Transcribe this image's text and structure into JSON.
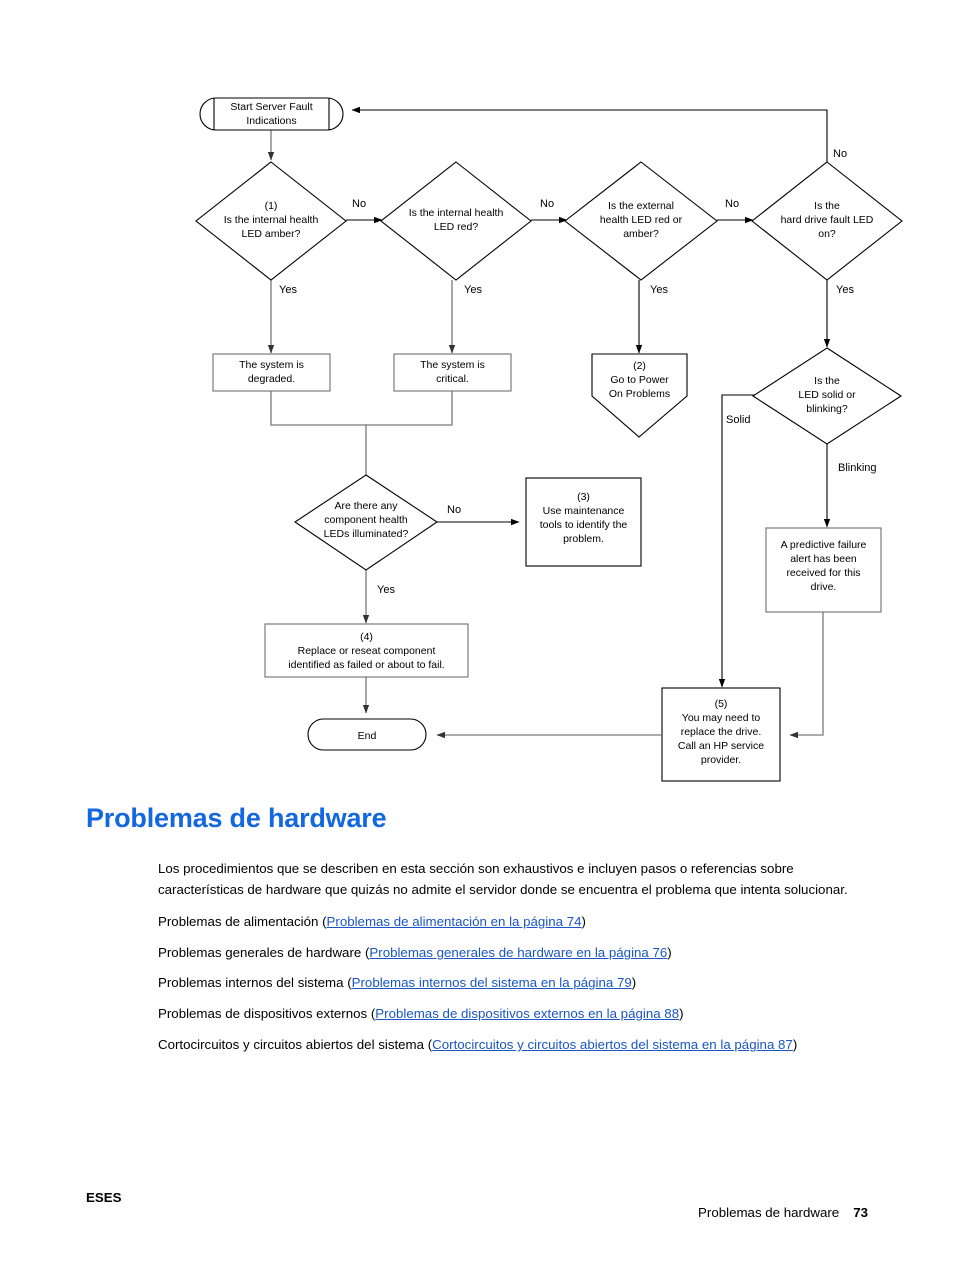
{
  "document": {
    "page_title": "Problemas de hardware",
    "heading_color": "#1367e0",
    "link_color": "#1a56c4"
  },
  "flowchart": {
    "title": "Server Fault Indications flowchart",
    "nodes": {
      "start": {
        "line1": "Start Server Fault",
        "line2": "Indications"
      },
      "q_internal_amber": {
        "line1": "(1)",
        "line2": "Is the internal health",
        "line3": "LED amber?"
      },
      "q_internal_red": {
        "line1": "Is the internal health",
        "line2": "LED red?"
      },
      "q_external": {
        "line1": "Is the external",
        "line2": "health LED red or",
        "line3": "amber?"
      },
      "q_hdd_fault": {
        "line1": "Is the",
        "line2": "hard drive fault LED",
        "line3": "on?"
      },
      "box_degraded": {
        "line1": "The system is",
        "line2": "degraded."
      },
      "box_critical": {
        "line1": "The system is",
        "line2": "critical."
      },
      "pent_power_on": {
        "line1": "(2)",
        "line2": "Go to Power",
        "line3": "On Problems"
      },
      "q_led_solid": {
        "line1": "Is the",
        "line2": "LED solid or",
        "line3": "blinking?"
      },
      "q_component_leds": {
        "line1": "Are there any",
        "line2": "component health",
        "line3": "LEDs illuminated?"
      },
      "box_maintenance": {
        "line1": "(3)",
        "line2": "Use maintenance",
        "line3": "tools to identify the",
        "line4": "problem."
      },
      "box_predictive": {
        "line1": "A predictive failure",
        "line2": "alert has been",
        "line3": "received for this",
        "line4": "drive."
      },
      "box_replace_component": {
        "line1": "(4)",
        "line2": "Replace or reseat component",
        "line3": "identified as failed or about to fail."
      },
      "box_replace_drive": {
        "line1": "(5)",
        "line2": "You may need to",
        "line3": "replace the drive.",
        "line4": "Call an HP service",
        "line5": "provider."
      },
      "end": {
        "line1": "End"
      }
    },
    "edge_labels": {
      "no_1": "No",
      "no_2": "No",
      "no_3": "No",
      "no_loopback": "No",
      "no_component": "No",
      "yes_1": "Yes",
      "yes_2": "Yes",
      "yes_3": "Yes",
      "yes_4": "Yes",
      "yes_component": "Yes",
      "solid": "Solid",
      "blinking": "Blinking"
    }
  },
  "content": {
    "intro": "Los procedimientos que se describen en esta sección son exhaustivos e incluyen pasos o referencias sobre características de hardware que quizás no admite el servidor donde se encuentra el problema que intenta solucionar.",
    "links": [
      {
        "prefix": "Problemas de alimentación (",
        "link": "Problemas de alimentación en la página 74",
        "suffix": ")"
      },
      {
        "prefix": "Problemas generales de hardware (",
        "link": "Problemas generales de hardware en la página 76",
        "suffix": ")"
      },
      {
        "prefix": "Problemas internos del sistema (",
        "link": "Problemas internos del sistema en la página 79",
        "suffix": ")"
      },
      {
        "prefix": "Problemas de dispositivos externos (",
        "link": "Problemas de dispositivos externos en la página 88",
        "suffix": ")"
      },
      {
        "prefix": "Cortocircuitos y circuitos abiertos del sistema (",
        "link": "Cortocircuitos y circuitos abiertos del sistema en la página 87",
        "suffix": ")"
      }
    ]
  },
  "footer": {
    "locale": "ESES",
    "section": "Problemas de hardware",
    "page_number": "73"
  }
}
